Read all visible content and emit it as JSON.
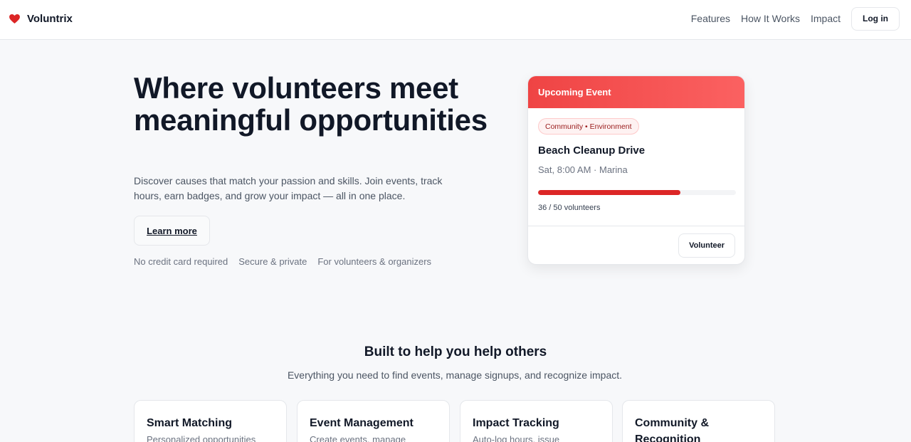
{
  "brand": {
    "name": "Voluntrix",
    "icon": "heart-icon",
    "accent": "#dc2626"
  },
  "nav": {
    "links": [
      "Features",
      "How It Works",
      "Impact"
    ],
    "login_label": "Log in"
  },
  "hero": {
    "title": "Where volunteers meet meaningful opportunities",
    "subtitle": "Discover causes that match your passion and skills. Join events, track hours, earn badges, and grow your impact — all in one place.",
    "cta_label": "Learn more",
    "trust": [
      "No credit card required",
      "Secure & private",
      "For volunteers & organizers"
    ]
  },
  "event": {
    "header": "Upcoming Event",
    "tag": "Community • Environment",
    "title": "Beach Cleanup Drive",
    "meta": "Sat, 8:00 AM · Marina",
    "progress_fraction": 0.72,
    "count_text": "36 / 50 volunteers",
    "button_label": "Volunteer"
  },
  "features": {
    "title": "Built to help you help others",
    "subtitle": "Everything you need to find events, manage signups, and recognize impact.",
    "cards": [
      {
        "name": "Smart Matching",
        "desc": "Personalized opportunities"
      },
      {
        "name": "Event Management",
        "desc": "Create events, manage"
      },
      {
        "name": "Impact Tracking",
        "desc": "Auto-log hours, issue"
      },
      {
        "name": "Community & Recognition",
        "desc": ""
      }
    ]
  }
}
